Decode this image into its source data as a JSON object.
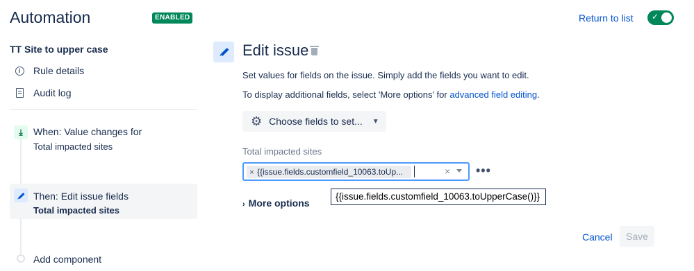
{
  "header": {
    "title": "Automation",
    "status_badge": "ENABLED",
    "return_link": "Return to list",
    "toggle_on": true
  },
  "sidebar": {
    "rule_name": "TT Site to upper case",
    "items": [
      {
        "label": "Rule details",
        "icon": "info-icon"
      },
      {
        "label": "Audit log",
        "icon": "document-icon"
      }
    ],
    "steps": [
      {
        "title": "When: Value changes for",
        "subtitle": "Total impacted sites",
        "icon": "trigger-icon"
      },
      {
        "title": "Then: Edit issue fields",
        "subtitle": "Total impacted sites",
        "icon": "pencil-icon",
        "selected": true
      }
    ],
    "add_component": "Add component"
  },
  "main": {
    "title": "Edit issue",
    "description": "Set values for fields on the issue. Simply add the fields you want to edit.",
    "more_info_prefix": "To display additional fields, select 'More options' for ",
    "more_info_link": "advanced field editing",
    "more_info_suffix": ".",
    "choose_fields_label": "Choose fields to set...",
    "field_label": "Total impacted sites",
    "field_chip_value": "{{issue.fields.customfield_10063.toUp...",
    "more_options_label": "More options",
    "tooltip_text": "{{issue.fields.customfield_10063.toUpperCase()}}",
    "cancel_label": "Cancel",
    "save_label": "Save"
  },
  "colors": {
    "accent": "#0052cc",
    "success": "#00875a",
    "focus_border": "#4c9aff"
  }
}
